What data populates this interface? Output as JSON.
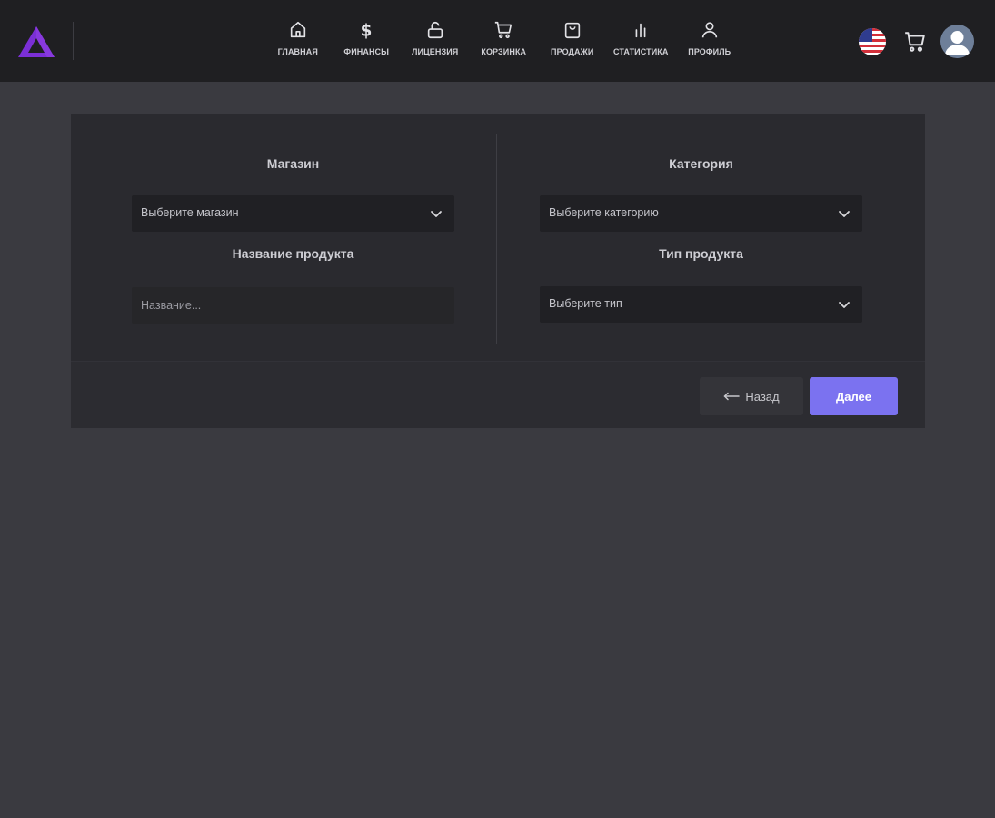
{
  "colors": {
    "accent": "#7b72f0",
    "logo": "#7b2fd6",
    "topbar_bg": "#1f1f22",
    "page_bg": "#3a3a40",
    "card_bg": "#2a2a2f"
  },
  "nav": {
    "items": [
      {
        "label": "ГЛАВНАЯ",
        "icon": "home-icon"
      },
      {
        "label": "ФИНАНСЫ",
        "icon": "dollar-icon"
      },
      {
        "label": "ЛИЦЕНЗИЯ",
        "icon": "lock-icon"
      },
      {
        "label": "КОРЗИНКА",
        "icon": "cart-icon"
      },
      {
        "label": "ПРОДАЖИ",
        "icon": "shopping-bag-icon"
      },
      {
        "label": "СТАТИСТИКА",
        "icon": "bar-chart-icon"
      },
      {
        "label": "ПРОФИЛЬ",
        "icon": "user-icon"
      }
    ]
  },
  "header_right": {
    "flag_icon": "us-flag-icon",
    "cart_icon": "cart-icon",
    "avatar_icon": "avatar-icon"
  },
  "form": {
    "store": {
      "label": "Магазин",
      "placeholder": "Выберите магазин"
    },
    "product_name": {
      "label": "Название продукта",
      "placeholder": "Название..."
    },
    "category": {
      "label": "Категория",
      "placeholder": "Выберите категорию"
    },
    "product_type": {
      "label": "Тип продукта",
      "placeholder": "Выберите тип"
    }
  },
  "footer": {
    "back_label": "Назад",
    "next_label": "Далее"
  }
}
